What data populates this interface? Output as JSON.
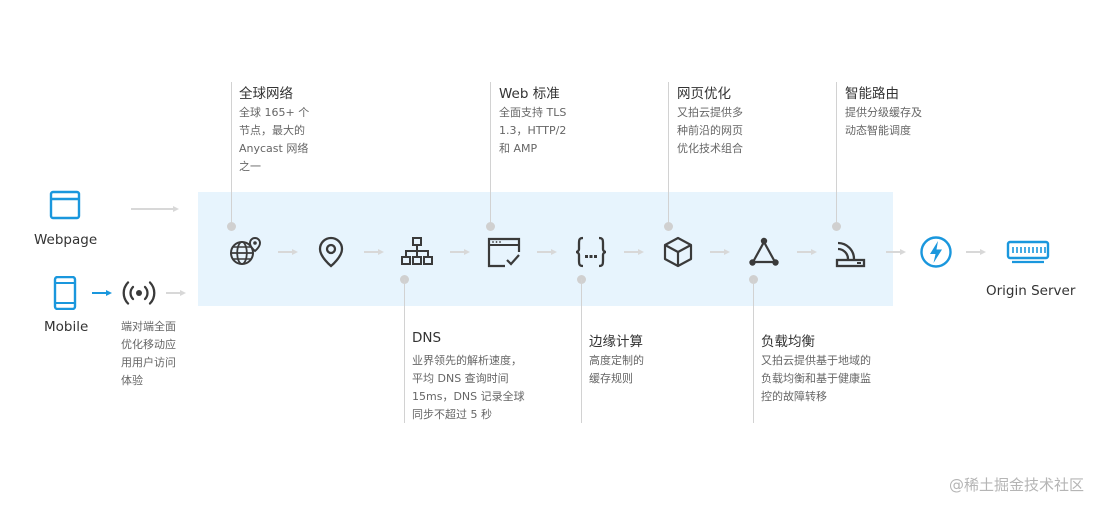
{
  "left_nodes": {
    "webpage_label": "Webpage",
    "mobile_label": "Mobile",
    "mobile_optimize_desc": [
      "端对端全面",
      "优化移动应",
      "用用户访问",
      "体验"
    ]
  },
  "top_features": [
    {
      "title": "全球网络",
      "desc": [
        "全球 165+ 个",
        "节点，最大的",
        "Anycast 网络",
        "之一"
      ]
    },
    {
      "title": "Web 标准",
      "desc": [
        "全面支持 TLS",
        "1.3，HTTP/2",
        "和 AMP"
      ]
    },
    {
      "title": "网页优化",
      "desc": [
        "又拍云提供多",
        "种前沿的网页",
        "优化技术组合"
      ]
    },
    {
      "title": "智能路由",
      "desc": [
        "提供分级缓存及",
        "动态智能调度"
      ]
    }
  ],
  "bottom_features": [
    {
      "title": "DNS",
      "desc": [
        "业界领先的解析速度，",
        "平均 DNS 查询时间",
        "15ms，DNS 记录全球",
        "同步不超过 5 秒"
      ]
    },
    {
      "title": "边缘计算",
      "desc": [
        "高度定制的",
        "缓存规则"
      ]
    },
    {
      "title": "负载均衡",
      "desc": [
        "又拍云提供基于地域的",
        "负载均衡和基于健康监",
        "控的故障转移"
      ]
    }
  ],
  "origin_label": "Origin Server",
  "watermark": "@稀土掘金技术社区",
  "colors": {
    "accent": "#1a97dd",
    "band": "#e7f4fd",
    "icon_dark": "#3a3a3a",
    "connector": "#d2d2d2"
  }
}
